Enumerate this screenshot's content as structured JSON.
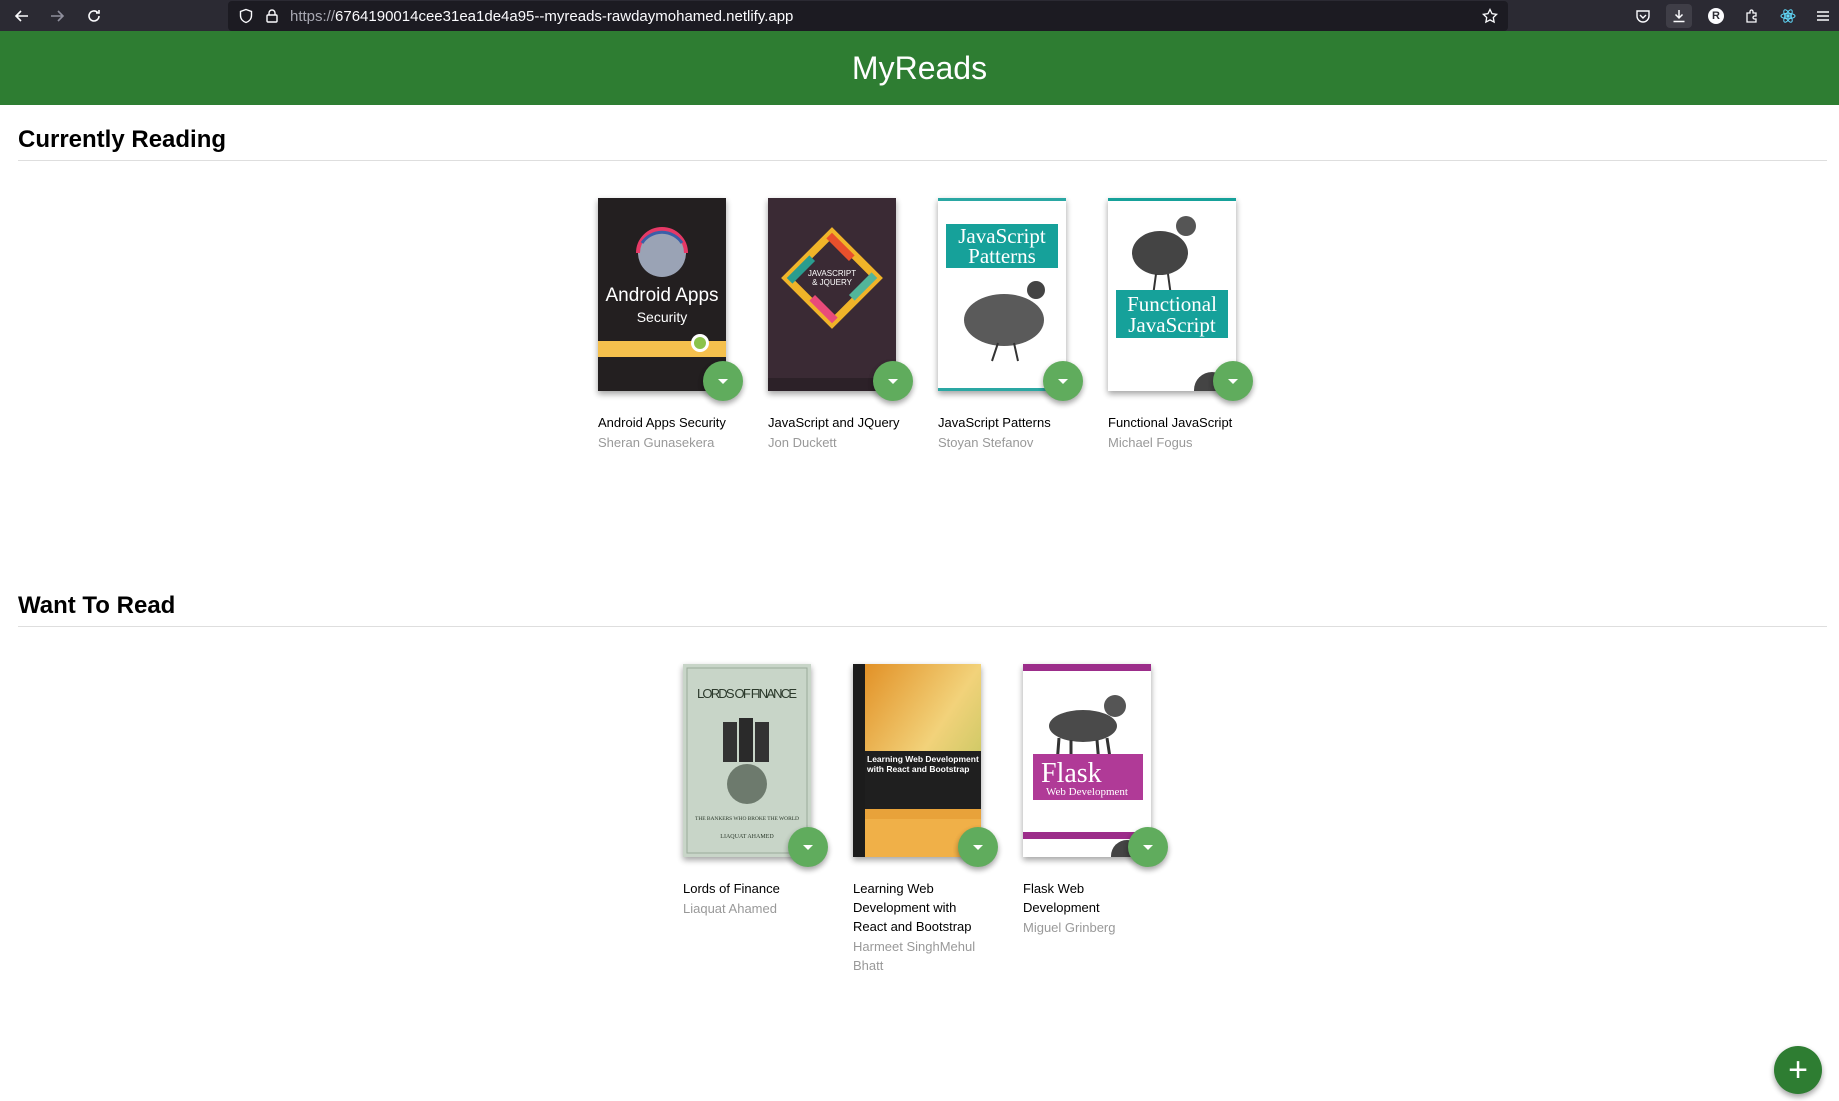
{
  "browser": {
    "url_scheme": "https://",
    "url_host": "6764190014cee31ea1de4a95--myreads-rawdaymohamed.netlify.app",
    "profile_initial": "R"
  },
  "app": {
    "title": "MyReads"
  },
  "shelves": [
    {
      "title": "Currently Reading",
      "books": [
        {
          "title": "Android Apps Security",
          "authors": "Sheran Gunasekera",
          "cover_theme": "android"
        },
        {
          "title": "JavaScript and JQuery",
          "authors": "Jon Duckett",
          "cover_theme": "jquery"
        },
        {
          "title": "JavaScript Patterns",
          "authors": "Stoyan Stefanov",
          "cover_theme": "patterns"
        },
        {
          "title": "Functional JavaScript",
          "authors": "Michael Fogus",
          "cover_theme": "functional"
        }
      ]
    },
    {
      "title": "Want To Read",
      "books": [
        {
          "title": "Lords of Finance",
          "authors": "Liaquat Ahamed",
          "cover_theme": "finance"
        },
        {
          "title": "Learning Web Development with React and Bootstrap",
          "authors": "Harmeet SinghMehul Bhatt",
          "cover_theme": "react"
        },
        {
          "title": "Flask Web Development",
          "authors": "Miguel Grinberg",
          "cover_theme": "flask"
        }
      ]
    }
  ],
  "covers": {
    "android": {
      "line1": "Android Apps",
      "line2": "Security"
    },
    "jquery": {
      "line1": "JAVASCRIPT",
      "line2": "& JQUERY"
    },
    "patterns": {
      "line1": "JavaScript",
      "line2": "Patterns"
    },
    "functional": {
      "line1": "Functional",
      "line2": "JavaScript"
    },
    "finance": {
      "line1": "LORDS OF FINANCE",
      "line2": "THE BANKERS WHO BROKE THE WORLD",
      "line3": "LIAQUAT AHAMED"
    },
    "react": {
      "line1": "Learning Web Development with React and Bootstrap"
    },
    "flask": {
      "line1": "Flask",
      "line2": "Web Development"
    }
  },
  "fab": {
    "label": "+"
  },
  "colors": {
    "header": "#2e7d32",
    "changer": "#60ac5d",
    "fab": "#2e7d32"
  }
}
